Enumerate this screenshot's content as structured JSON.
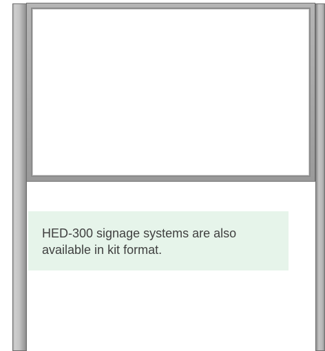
{
  "caption": {
    "text": "HED-300 signage systems are also available in kit format."
  }
}
